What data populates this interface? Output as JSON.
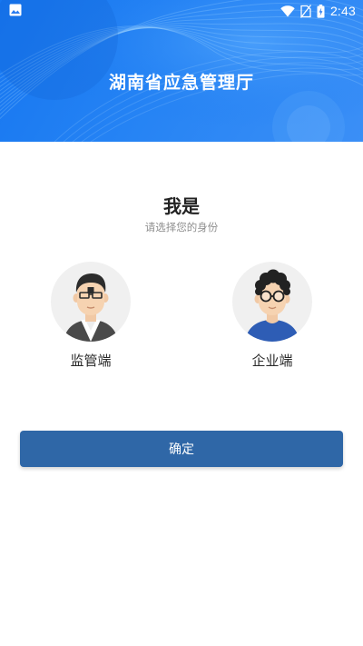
{
  "status_bar": {
    "time": "2:43",
    "icons": [
      "gallery-icon",
      "wifi-icon",
      "no-sim-icon",
      "battery-charging-icon"
    ]
  },
  "banner": {
    "title": "湖南省应急管理厅"
  },
  "identity": {
    "heading": "我是",
    "subheading": "请选择您的身份"
  },
  "roles": [
    {
      "label": "监管端",
      "icon": "supervisor-avatar-icon"
    },
    {
      "label": "企业端",
      "icon": "enterprise-avatar-icon"
    }
  ],
  "confirm_button": {
    "label": "确定"
  },
  "colors": {
    "banner_blue": "#1676f0",
    "button_blue": "#2f67a7",
    "heading_text": "#222222",
    "subtle_text": "#8e8e8e"
  }
}
